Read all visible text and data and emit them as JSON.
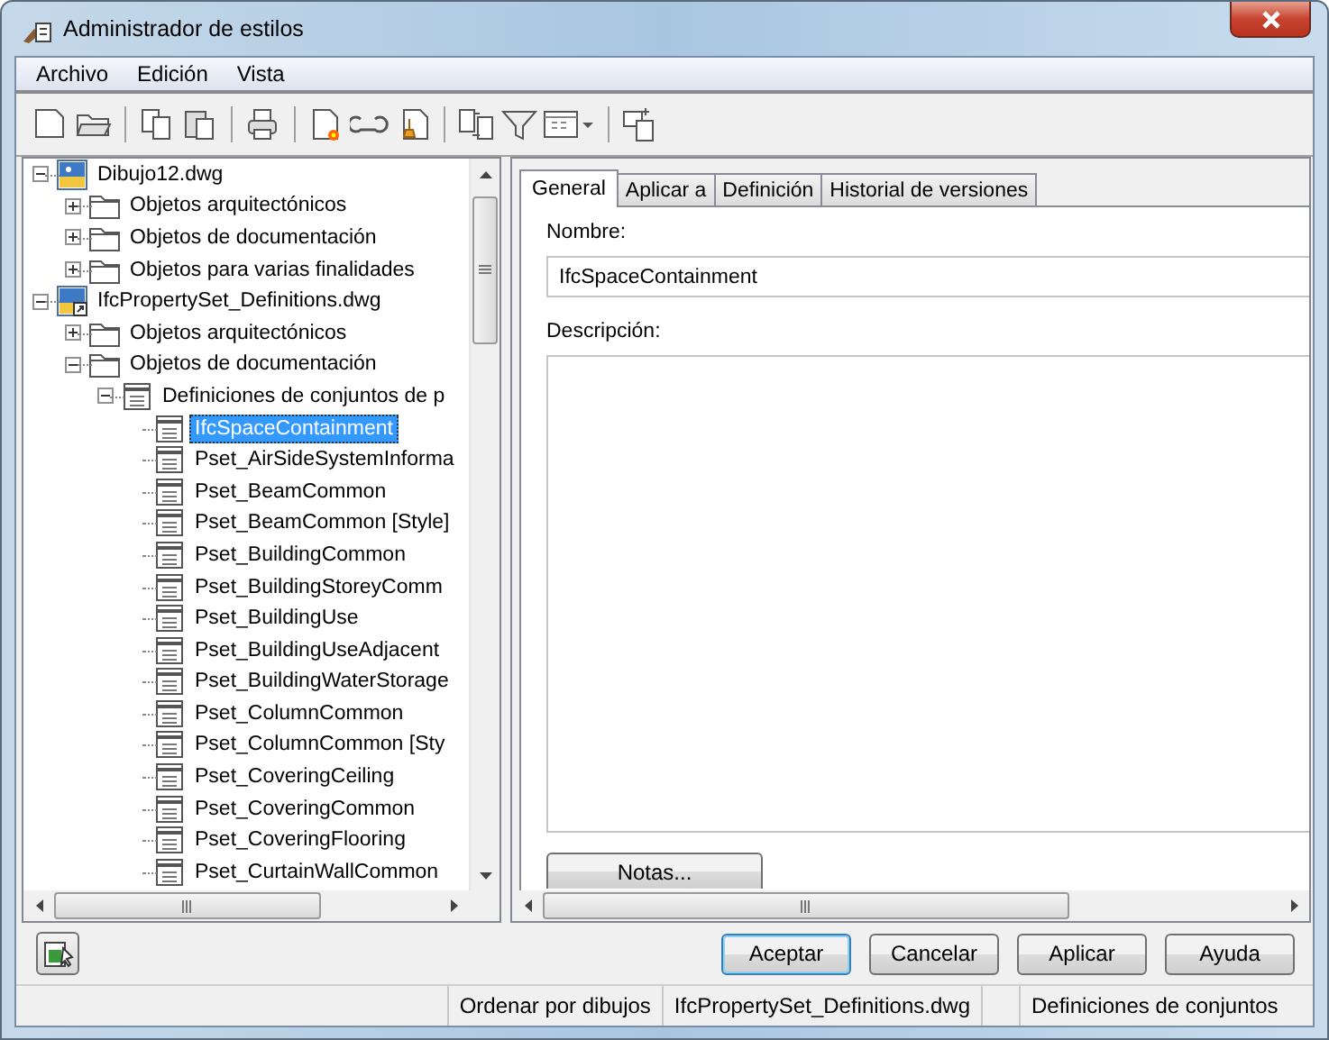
{
  "window": {
    "title": "Administrador de estilos"
  },
  "menu": [
    {
      "label": "Archivo"
    },
    {
      "label": "Edición"
    },
    {
      "label": "Vista"
    }
  ],
  "toolbar": [
    {
      "kind": "new"
    },
    {
      "kind": "open"
    },
    {
      "kind": "separator"
    },
    {
      "kind": "copy"
    },
    {
      "kind": "paste"
    },
    {
      "kind": "separator"
    },
    {
      "kind": "purge"
    },
    {
      "kind": "separator"
    },
    {
      "kind": "new-style"
    },
    {
      "kind": "loop"
    },
    {
      "kind": "edit-style"
    },
    {
      "kind": "separator"
    },
    {
      "kind": "compare"
    },
    {
      "kind": "filter"
    },
    {
      "kind": "view"
    },
    {
      "kind": "separator"
    },
    {
      "kind": "sync"
    }
  ],
  "tree": [
    {
      "label": "Dibujo12.dwg",
      "kind": "drawing",
      "expanded": true,
      "selected": false,
      "children": [
        {
          "label": "Objetos arquitectónicos",
          "kind": "folder",
          "expanded": false,
          "selected": false
        },
        {
          "label": "Objetos de documentación",
          "kind": "folder",
          "expanded": false,
          "selected": false
        },
        {
          "label": "Objetos para varias finalidades",
          "kind": "folder",
          "expanded": false,
          "selected": false
        }
      ]
    },
    {
      "label": "IfcPropertySet_Definitions.dwg",
      "kind": "linked-drawing",
      "expanded": true,
      "selected": false,
      "children": [
        {
          "label": "Objetos arquitectónicos",
          "kind": "folder",
          "expanded": false,
          "selected": false
        },
        {
          "label": "Objetos de documentación",
          "kind": "folder",
          "expanded": true,
          "selected": false,
          "children": [
            {
              "label": "Definiciones de conjuntos de p",
              "kind": "list",
              "expanded": true,
              "selected": false,
              "children": [
                {
                  "label": "IfcSpaceContainment",
                  "kind": "style",
                  "selected": true
                },
                {
                  "label": "Pset_AirSideSystemInforma",
                  "kind": "style",
                  "selected": false
                },
                {
                  "label": "Pset_BeamCommon",
                  "kind": "style",
                  "selected": false
                },
                {
                  "label": "Pset_BeamCommon [Style]",
                  "kind": "style",
                  "selected": false
                },
                {
                  "label": "Pset_BuildingCommon",
                  "kind": "style",
                  "selected": false
                },
                {
                  "label": "Pset_BuildingStoreyComm",
                  "kind": "style",
                  "selected": false
                },
                {
                  "label": "Pset_BuildingUse",
                  "kind": "style",
                  "selected": false
                },
                {
                  "label": "Pset_BuildingUseAdjacent",
                  "kind": "style",
                  "selected": false
                },
                {
                  "label": "Pset_BuildingWaterStorage",
                  "kind": "style",
                  "selected": false
                },
                {
                  "label": "Pset_ColumnCommon",
                  "kind": "style",
                  "selected": false
                },
                {
                  "label": "Pset_ColumnCommon [Sty",
                  "kind": "style",
                  "selected": false
                },
                {
                  "label": "Pset_CoveringCeiling",
                  "kind": "style",
                  "selected": false
                },
                {
                  "label": "Pset_CoveringCommon",
                  "kind": "style",
                  "selected": false
                },
                {
                  "label": "Pset_CoveringFlooring",
                  "kind": "style",
                  "selected": false
                },
                {
                  "label": "Pset_CurtainWallCommon",
                  "kind": "style",
                  "selected": false
                }
              ]
            }
          ]
        }
      ]
    }
  ],
  "tabs": [
    {
      "label": "General",
      "selected": true
    },
    {
      "label": "Aplicar a",
      "selected": false
    },
    {
      "label": "Definición",
      "selected": false
    },
    {
      "label": "Historial de versiones",
      "selected": false
    }
  ],
  "general": {
    "name_label": "Nombre:",
    "name_value": "IfcSpaceContainment",
    "description_label": "Descripción:",
    "notes_button": "Notas..."
  },
  "buttons": [
    {
      "label": "Aceptar",
      "default": true
    },
    {
      "label": "Cancelar",
      "default": false
    },
    {
      "label": "Aplicar",
      "default": false
    },
    {
      "label": "Ayuda",
      "default": false
    }
  ],
  "status_bar": [
    "Ordenar por dibujos",
    "IfcPropertySet_Definitions.dwg",
    "Definiciones de conjuntos"
  ]
}
